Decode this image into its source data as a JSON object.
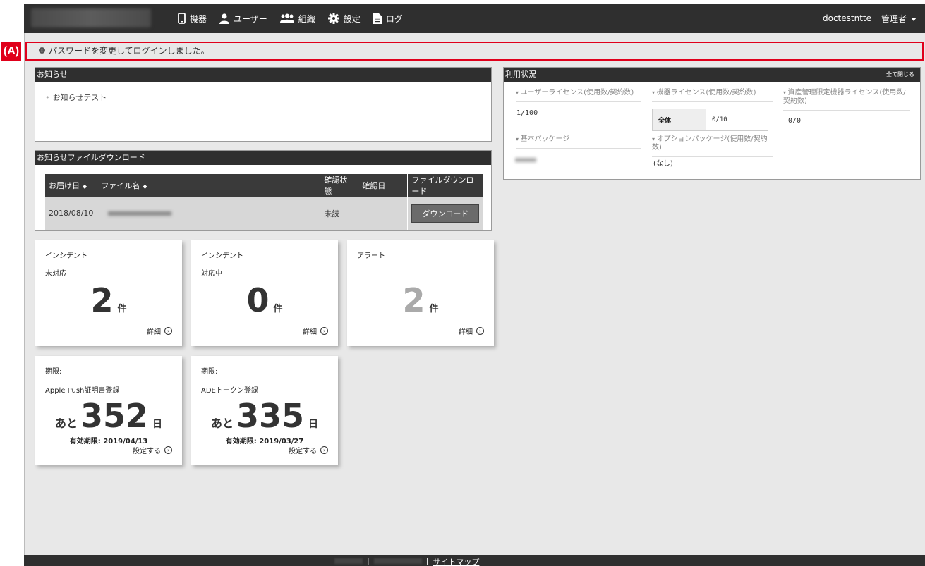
{
  "header": {
    "nav": [
      {
        "icon": "smartphone-icon",
        "label": "機器"
      },
      {
        "icon": "user-icon",
        "label": "ユーザー"
      },
      {
        "icon": "group-icon",
        "label": "組織"
      },
      {
        "icon": "gear-icon",
        "label": "設定"
      },
      {
        "icon": "document-icon",
        "label": "ログ"
      }
    ],
    "username": "doctestntte",
    "role": "管理者"
  },
  "annotation": {
    "label": "(A)",
    "color": "#e0001b"
  },
  "message": "パスワードを変更してログインしました。",
  "notice": {
    "title": "お知らせ",
    "items": [
      "お知らせテスト"
    ]
  },
  "download": {
    "title": "お知らせファイルダウンロード",
    "columns": [
      "お届け日",
      "ファイル名",
      "確認状態",
      "確認日",
      "ファイルダウンロード"
    ],
    "rows": [
      {
        "date": "2018/08/10",
        "status": "未読",
        "confirmed": "",
        "button": "ダウンロード"
      }
    ]
  },
  "usage": {
    "title": "利用状況",
    "collapse": "全て閉じる",
    "user_license_label": "ユーザーライセンス(使用数/契約数)",
    "user_license_value": "1/100",
    "device_license_label": "機器ライセンス(使用数/契約数)",
    "device_all_label": "全体",
    "device_all_value": "0/10",
    "asset_license_label": "資産管理限定機器ライセンス(使用数/契約数)",
    "asset_license_value": "0/0",
    "basic_pkg_label": "基本パッケージ",
    "option_pkg_label": "オプションパッケージ(使用数/契約数)",
    "option_pkg_value": "(なし)"
  },
  "cards": [
    {
      "t1": "インシデント",
      "t2": "未対応",
      "count": "2",
      "unit": "件",
      "link": "詳細"
    },
    {
      "t1": "インシデント",
      "t2": "対応中",
      "count": "0",
      "unit": "件",
      "link": "詳細"
    },
    {
      "t1": "アラート",
      "t2": "",
      "count": "2",
      "unit": "件",
      "link": "詳細"
    }
  ],
  "expiry_cards": [
    {
      "t1": "期限:",
      "title": "Apple Push証明書登録",
      "pre": "あと",
      "days": "352",
      "suf": "日",
      "expiry": "有効期限: 2019/04/13",
      "link": "設定する"
    },
    {
      "t1": "期限:",
      "title": "ADEトークン登録",
      "pre": "あと",
      "days": "335",
      "suf": "日",
      "expiry": "有効期限: 2019/03/27",
      "link": "設定する"
    }
  ],
  "footer": {
    "sep": "|",
    "sitemap": "サイトマップ"
  }
}
